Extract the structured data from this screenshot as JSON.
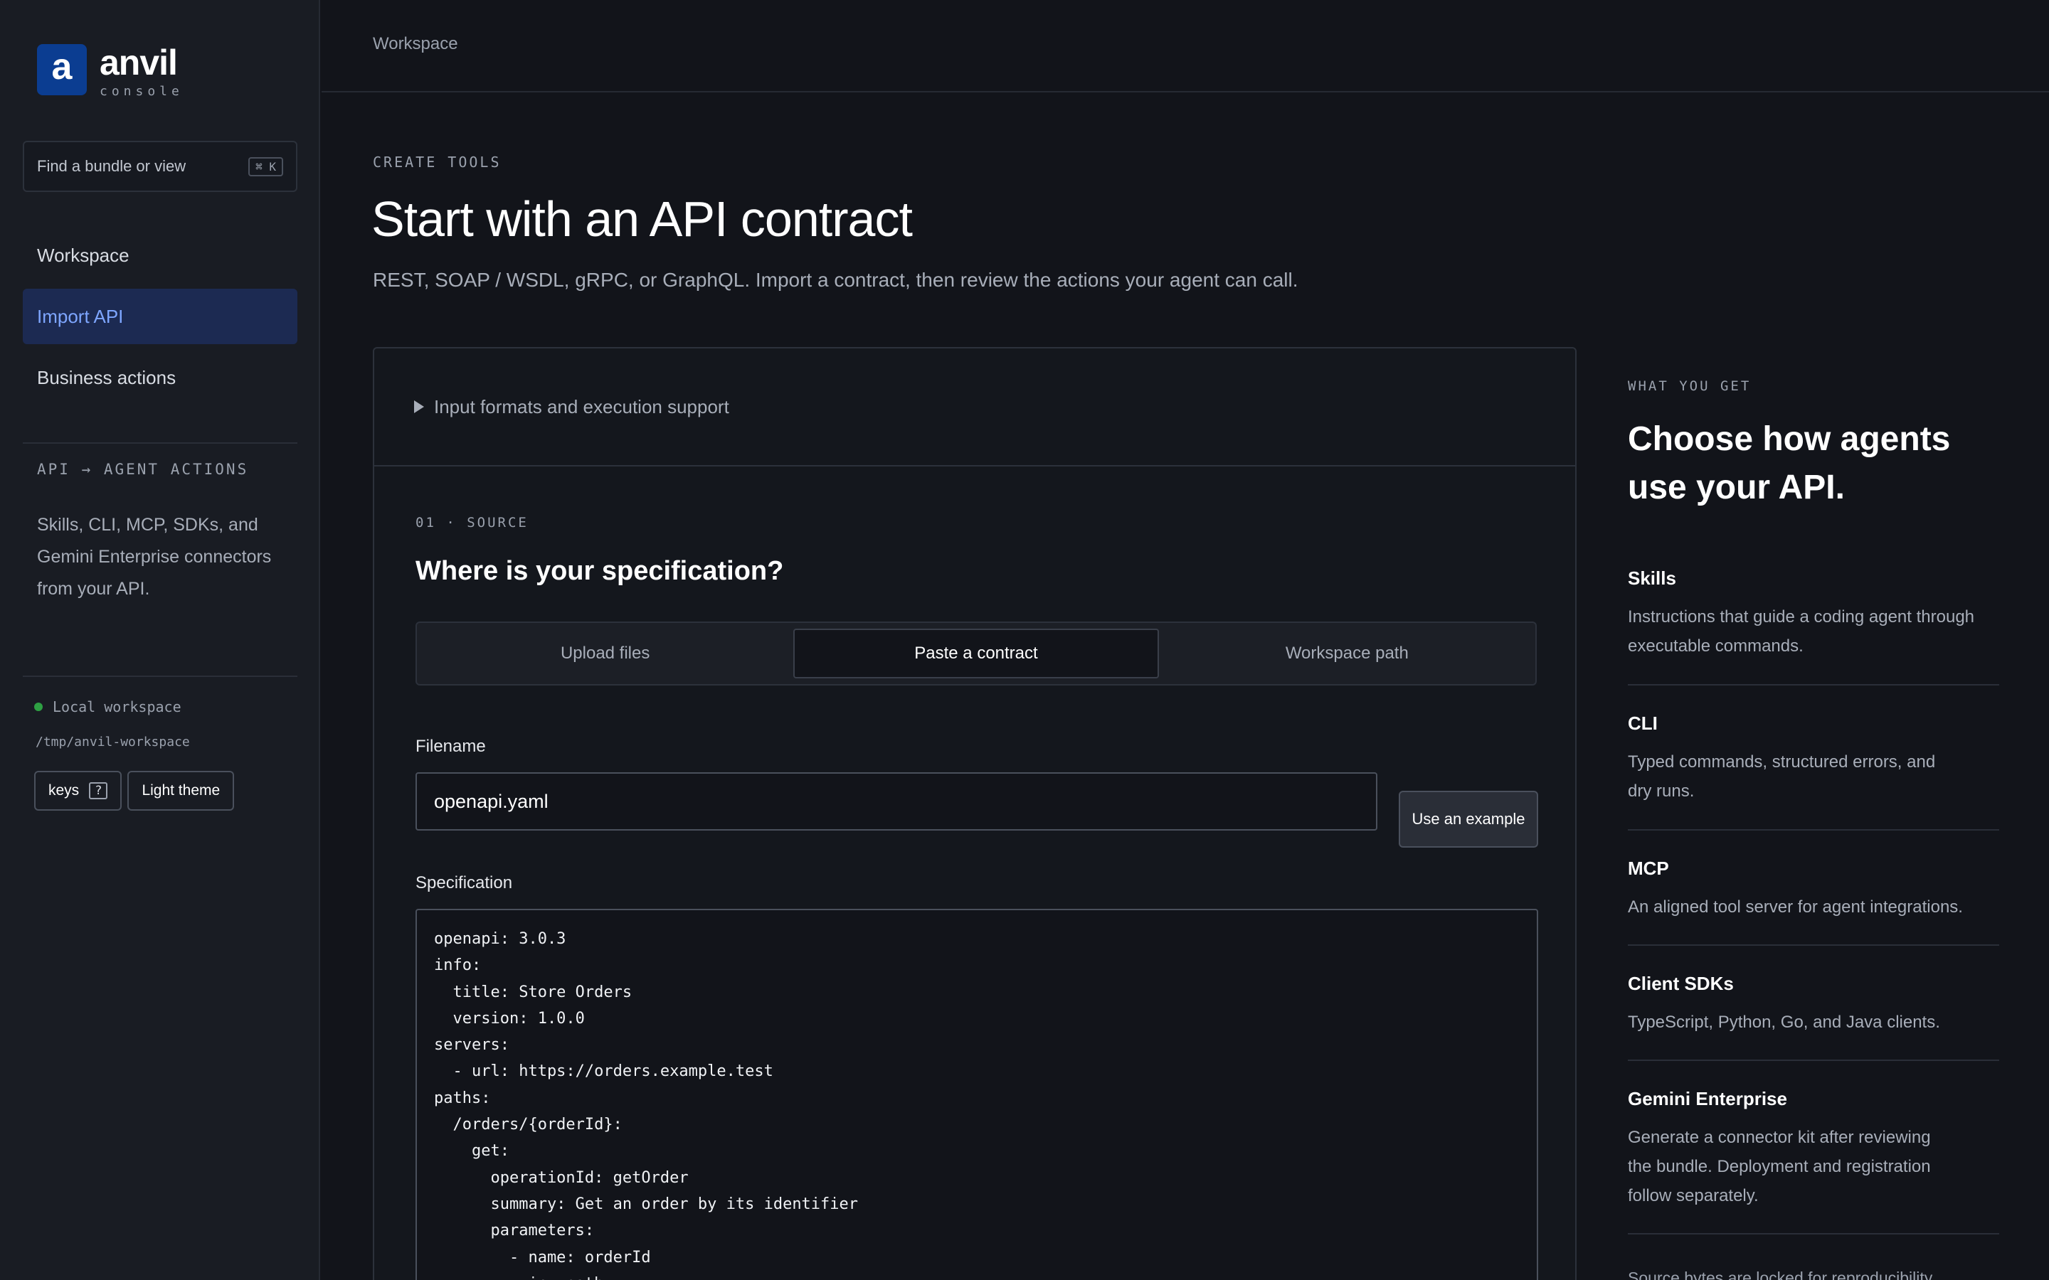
{
  "brand": {
    "logo_letter": "a",
    "name": "anvil",
    "subtitle": "console"
  },
  "search": {
    "placeholder": "Find a bundle or view",
    "shortcut": "⌘ K"
  },
  "nav": {
    "items": [
      {
        "label": "Workspace"
      },
      {
        "label": "Import API",
        "active": true
      },
      {
        "label": "Business actions"
      }
    ]
  },
  "sidebar_section": {
    "title": "API → AGENT ACTIONS",
    "description": "Skills, CLI, MCP, SDKs, and Gemini Enterprise connectors from your API."
  },
  "workspace": {
    "status": "Local workspace",
    "status_color": "#2ea043",
    "path": "/tmp/anvil-workspace",
    "keys_label": "keys",
    "keys_hint": "?",
    "theme_label": "Light theme"
  },
  "breadcrumb": "Workspace",
  "header": {
    "eyebrow": "CREATE TOOLS",
    "title": "Start with an API contract",
    "subtitle": "REST, SOAP / WSDL, gRPC, or GraphQL. Import a contract, then review the actions your agent can call."
  },
  "disclosure": {
    "label": "Input formats and execution support"
  },
  "source": {
    "step": "01 · SOURCE",
    "title": "Where is your specification?",
    "tabs": [
      {
        "label": "Upload files"
      },
      {
        "label": "Paste a contract",
        "active": true
      },
      {
        "label": "Workspace path"
      }
    ],
    "filename_label": "Filename",
    "filename_value": "openapi.yaml",
    "example_button": "Use an example",
    "spec_label": "Specification",
    "spec_text": "openapi: 3.0.3\ninfo:\n  title: Store Orders\n  version: 1.0.0\nservers:\n  - url: https://orders.example.test\npaths:\n  /orders/{orderId}:\n    get:\n      operationId: getOrder\n      summary: Get an order by its identifier\n      parameters:\n        - name: orderId\n          in: path"
  },
  "what_you_get": {
    "eyebrow": "WHAT YOU GET",
    "title": "Choose how agents use your API.",
    "features": [
      {
        "name": "Skills",
        "description": "Instructions that guide a coding agent through executable commands."
      },
      {
        "name": "CLI",
        "description": "Typed commands, structured errors, and dry runs."
      },
      {
        "name": "MCP",
        "description": "An aligned tool server for agent integrations."
      },
      {
        "name": "Client SDKs",
        "description": "TypeScript, Python, Go, and Java clients."
      },
      {
        "name": "Gemini Enterprise",
        "description": "Generate a connector kit after reviewing the bundle. Deployment and registration follow separately."
      }
    ],
    "footnote": "Source bytes are locked for reproducibility."
  },
  "colors": {
    "accent": "#7ea6ff",
    "brand": "#0b3d91",
    "active_nav_bg": "#1c2a52"
  }
}
